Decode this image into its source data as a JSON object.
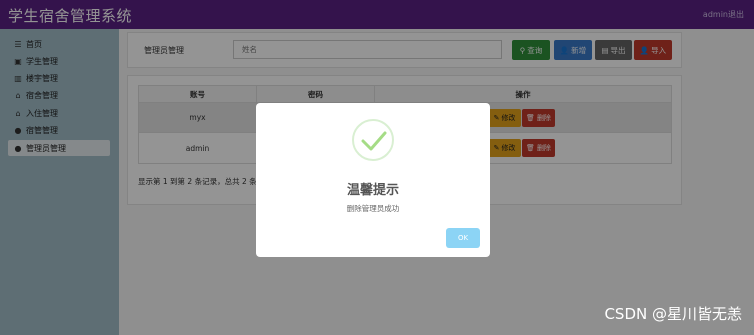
{
  "header": {
    "app_title": "学生宿舍管理系统",
    "admin_name": "admin退出"
  },
  "sidebar": {
    "items": [
      {
        "label": "首页",
        "icon": "menu-icon"
      },
      {
        "label": "学生管理",
        "icon": "id-card-icon"
      },
      {
        "label": "楼宇管理",
        "icon": "building-icon"
      },
      {
        "label": "宿舍管理",
        "icon": "home-icon"
      },
      {
        "label": "入住管理",
        "icon": "home-icon"
      },
      {
        "label": "宿管管理",
        "icon": "user-icon"
      },
      {
        "label": "管理员管理",
        "icon": "user-icon",
        "active": true
      }
    ]
  },
  "search": {
    "label": "管理员管理",
    "placeholder": "姓名",
    "buttons": {
      "query": "查询",
      "add": "新增",
      "export": "导出",
      "import": "导入"
    }
  },
  "table": {
    "columns": [
      "账号",
      "密码",
      "操作"
    ],
    "rows": [
      {
        "account": "myx",
        "password": ""
      },
      {
        "account": "admin",
        "password": ""
      }
    ],
    "actions": {
      "edit": "修改",
      "delete": "删除"
    },
    "footer": "显示第 1 到第 2 条记录，总共 2 条"
  },
  "modal": {
    "title": "温馨提示",
    "message": "删除管理员成功",
    "ok": "OK"
  },
  "watermark": "CSDN @星川皆无恙",
  "colors": {
    "topbar": "#5b2283",
    "sidebar": "#a2bec8",
    "success": "#2f8f3a",
    "primary": "#3a79c8",
    "danger": "#c0392b",
    "warning": "#e3a21a",
    "ok": "#8cd4f5"
  }
}
